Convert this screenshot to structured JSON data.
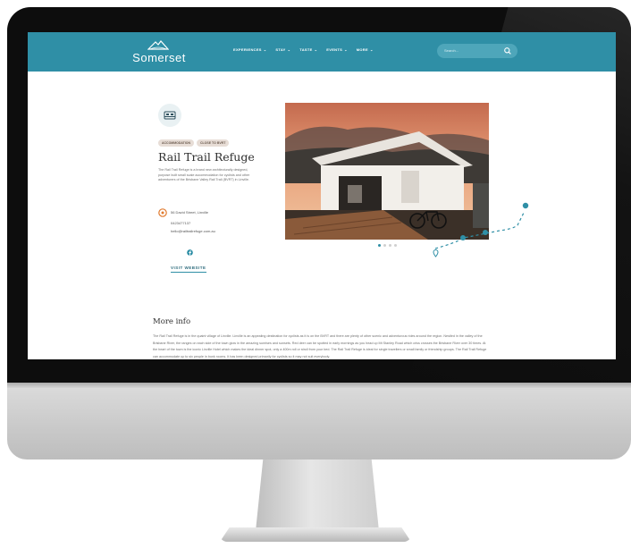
{
  "site": {
    "logo_text": "Somerset"
  },
  "nav": {
    "items": [
      {
        "label": "EXPERIENCES"
      },
      {
        "label": "STAY"
      },
      {
        "label": "TASTE"
      },
      {
        "label": "EVENTS"
      },
      {
        "label": "MORE"
      }
    ],
    "caret": "⌄"
  },
  "search": {
    "placeholder": "Search..."
  },
  "listing": {
    "tags": [
      "ACCOMMODATION",
      "CLOSE TO BVRT"
    ],
    "title": "Rail Trail Refuge",
    "description": "The Rail Trail Refuge is a brand new architecturally designed, purpose built small scale accommodation for cyclists and other adventurers of the Brisbane Valley Rail Trail (BVRT) in Linville.",
    "address": "56 David Street, Linville",
    "phone": "0423477137",
    "email": "hello@railtrailrefuge.com.au",
    "visit_label": "VISIT WEBSITE"
  },
  "gallery": {
    "slide_count": 4,
    "active_index": 0
  },
  "more_info": {
    "heading": "More info",
    "text": "The Rail Trail Refuge is in the quaint village of Linville. Linville is an appealing destination for cyclists as it is on the BVRT and there are plenty of other scenic and adventurous rides around the region. Nestled in the valley of the Brisbane River, the ranges on each side of the town glow in the amazing sunrises and sunsets. Red deer can be spotted in early mornings as you head up Mt Stanley Road which criss crosses the Brisbane River over 30 times. At the heart of the town is the iconic Linville Hotel which makes the ideal dinner spot, only a 400m roll or stroll from your bed. The Rail Trail Refuge is ideal for single travellers or small family or friendship groups. The Rail Trail Refuge can accommodate up to six people in bunk rooms. It has been designed primarily for cyclists so it may not suit everybody."
  },
  "colors": {
    "brand_teal": "#2f8fa6",
    "tag_bg": "#e7ddd6"
  },
  "icons": {
    "bed": "bed-icon",
    "pin": "map-pin-icon",
    "facebook": "facebook-icon",
    "search": "search-icon"
  }
}
